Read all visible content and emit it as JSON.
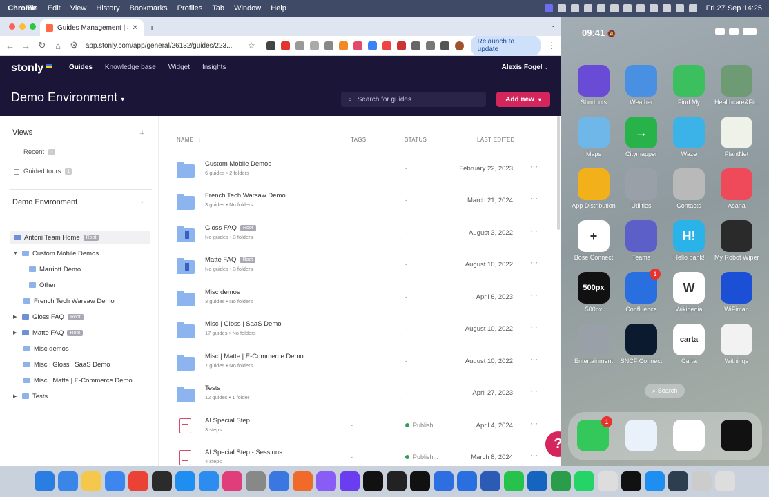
{
  "menubar": {
    "app": "Chrome",
    "items": [
      "File",
      "Edit",
      "View",
      "History",
      "Bookmarks",
      "Profiles",
      "Tab",
      "Window",
      "Help"
    ],
    "clock": "Fri 27 Sep 14:25"
  },
  "browser": {
    "tab_title": "Guides Management | Stonly",
    "url": "app.stonly.com/app/general/26132/guides/223...",
    "relaunch_label": "Relaunch to update"
  },
  "stonly": {
    "logo": "stonly",
    "nav": [
      "Guides",
      "Knowledge base",
      "Widget",
      "Insights"
    ],
    "user": "Alexis Fogel",
    "env_title": "Demo Environment",
    "search_placeholder": "Search for guides",
    "add_new": "Add new"
  },
  "sidebar": {
    "views_title": "Views",
    "views": [
      {
        "label": "Recent",
        "count": "1"
      },
      {
        "label": "Guided tours",
        "count": "1"
      }
    ],
    "env_title": "Demo Environment",
    "tree": [
      {
        "label": "Antoni Team Home",
        "badge": "Root"
      },
      {
        "label": "Custom Mobile Demos",
        "badge": ""
      },
      {
        "label": "Marriott Demo",
        "badge": ""
      },
      {
        "label": "Other",
        "badge": ""
      },
      {
        "label": "French Tech Warsaw Demo",
        "badge": ""
      },
      {
        "label": "Gloss FAQ",
        "badge": "Root"
      },
      {
        "label": "Matte FAQ",
        "badge": "Root"
      },
      {
        "label": "Misc demos",
        "badge": ""
      },
      {
        "label": "Misc | Gloss | SaaS Demo",
        "badge": ""
      },
      {
        "label": "Misc | Matte | E-Commerce Demo",
        "badge": ""
      },
      {
        "label": "Tests",
        "badge": ""
      }
    ]
  },
  "table": {
    "headers": {
      "name": "NAME",
      "tags": "TAGS",
      "status": "STATUS",
      "edited": "LAST EDITED"
    },
    "sort_arrow": "↑",
    "rows": [
      {
        "name": "Custom Mobile Demos",
        "badge": "",
        "guides": "6 guides",
        "folders": "2 folders",
        "tags": "",
        "status": "-",
        "date": "February 22, 2023"
      },
      {
        "name": "French Tech Warsaw Demo",
        "badge": "",
        "guides": "3 guides",
        "folders": "No folders",
        "tags": "",
        "status": "-",
        "date": "March 21, 2024"
      },
      {
        "name": "Gloss FAQ",
        "badge": "Root",
        "guides": "No guides",
        "folders": "3 folders",
        "tags": "",
        "status": "-",
        "date": "August 3, 2022"
      },
      {
        "name": "Matte FAQ",
        "badge": "Root",
        "guides": "No guides",
        "folders": "3 folders",
        "tags": "",
        "status": "-",
        "date": "August 10, 2022"
      },
      {
        "name": "Misc demos",
        "badge": "",
        "guides": "3 guides",
        "folders": "No folders",
        "tags": "",
        "status": "-",
        "date": "April 6, 2023"
      },
      {
        "name": "Misc | Gloss | SaaS Demo",
        "badge": "",
        "guides": "17 guides",
        "folders": "No folders",
        "tags": "",
        "status": "-",
        "date": "August 10, 2022"
      },
      {
        "name": "Misc | Matte | E-Commerce Demo",
        "badge": "",
        "guides": "7 guides",
        "folders": "No folders",
        "tags": "",
        "status": "-",
        "date": "August 10, 2022"
      },
      {
        "name": "Tests",
        "badge": "",
        "guides": "12 guides",
        "folders": "1 folder",
        "tags": "",
        "status": "-",
        "date": "April 27, 2023"
      },
      {
        "name": "AI Special Step",
        "badge": "",
        "guides": "3 steps",
        "folders": "",
        "tags": "-",
        "status": "Publish...",
        "date": "April 4, 2024"
      },
      {
        "name": "AI Special Step - Sessions",
        "badge": "",
        "guides": "4 steps",
        "folders": "",
        "tags": "-",
        "status": "Publish...",
        "date": "March 8, 2024"
      }
    ],
    "help_label": "?"
  },
  "phone": {
    "time": "09:41",
    "apps": [
      {
        "label": "Shortcuts",
        "color": "#6a4bd6",
        "glyph": "",
        "badge": ""
      },
      {
        "label": "Weather",
        "color": "#4a90e2",
        "glyph": "",
        "badge": ""
      },
      {
        "label": "Find My",
        "color": "#3bbf5f",
        "glyph": "",
        "badge": ""
      },
      {
        "label": "Healthcare&Fit...",
        "color": "#6e9a74",
        "glyph": "",
        "badge": ""
      },
      {
        "label": "Maps",
        "color": "#6fb7e8",
        "glyph": "",
        "badge": ""
      },
      {
        "label": "Citymapper",
        "color": "#27b34a",
        "glyph": "→",
        "badge": ""
      },
      {
        "label": "Waze",
        "color": "#3bb3e8",
        "glyph": "",
        "badge": ""
      },
      {
        "label": "PlantNet",
        "color": "#eef2e8",
        "glyph": "",
        "badge": ""
      },
      {
        "label": "App Distribution",
        "color": "#f2b01a",
        "glyph": "",
        "badge": ""
      },
      {
        "label": "Utilities",
        "color": "#9aa0a8",
        "glyph": "",
        "badge": ""
      },
      {
        "label": "Contacts",
        "color": "#b9b9b9",
        "glyph": "",
        "badge": ""
      },
      {
        "label": "Asana",
        "color": "#ef4a5a",
        "glyph": "",
        "badge": ""
      },
      {
        "label": "Bose Connect",
        "color": "#ffffff",
        "glyph": "+",
        "badge": ""
      },
      {
        "label": "Teams",
        "color": "#5b5fc7",
        "glyph": "",
        "badge": ""
      },
      {
        "label": "Hello bank!",
        "color": "#2ab3e8",
        "glyph": "H!",
        "badge": ""
      },
      {
        "label": "My Robot Wiper",
        "color": "#2a2a2a",
        "glyph": "",
        "badge": ""
      },
      {
        "label": "500px",
        "color": "#111111",
        "glyph": "500px",
        "badge": ""
      },
      {
        "label": "Confluence",
        "color": "#2a6fe0",
        "glyph": "",
        "badge": "1"
      },
      {
        "label": "Wikipedia",
        "color": "#ffffff",
        "glyph": "W",
        "badge": ""
      },
      {
        "label": "WiFiman",
        "color": "#1a4fd6",
        "glyph": "",
        "badge": ""
      },
      {
        "label": "Entertainment",
        "color": "#9aa0a8",
        "glyph": "",
        "badge": ""
      },
      {
        "label": "SNCF Connect",
        "color": "#0b1a2e",
        "glyph": "",
        "badge": ""
      },
      {
        "label": "Carta",
        "color": "#ffffff",
        "glyph": "carta",
        "badge": ""
      },
      {
        "label": "Withings",
        "color": "#f2f2f2",
        "glyph": "",
        "badge": ""
      }
    ],
    "search_label": "Search",
    "dock_badge": "1"
  }
}
